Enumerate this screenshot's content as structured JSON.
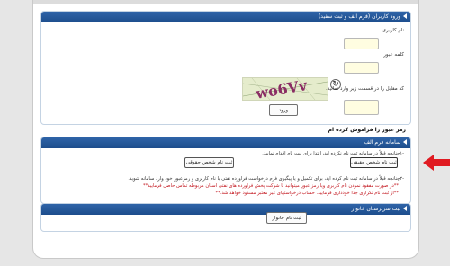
{
  "login": {
    "header": "ورود کاربران (فرم الف و ثبت سفید)",
    "username_label": "نام کاربری",
    "password_label": "کلمه عبور",
    "captcha_instruction": "کد مقابل را در قسمت زیر وارد نمائید.",
    "captcha_text": "wo6Vv",
    "submit_label": "ورود"
  },
  "forgot_password": "رمز عبور را فراموش کرده ام",
  "form_a": {
    "header": "سامانه فرم الف",
    "line1": "-۱چنانچه قبلاً در سامانه ثبت نام نکرده اید، ابتدا برای ثبت نام اقدام نمایید.",
    "natural_person_button": "ثبت نام شخص حقیقی",
    "legal_person_button": "ثبت نام شخص حقوقی",
    "line2": "-۲چنانچه قبلاً در سامانه ثبت نام کرده اید، برای تکمیل و یا پیگیری فرم درخواست فراورده نفتی با نام کاربری و رمزعبور خود وارد سامانه شوید.",
    "note_red1": "**در صورت مفقود نمودن نام کاربری ویا رمز عبور میتوانید با شرکت پخش فراورده های نفتی استان مربوطه تماس حاصل فرمایید**",
    "note_red2": "**از ثبت نام تکراری جدا خودداری فرمایید. حساب درخواستهای غیر معتبر مسدود خواهد شد.**"
  },
  "household": {
    "header": "ثبت سرپرستان خانوار",
    "register_button": "ثبت نام خانوار"
  },
  "colors": {
    "header_blue": "#1d4d8c",
    "input_yellow": "#fffde1",
    "arrow_red": "#e01b22"
  },
  "icons": {
    "refresh": "refresh-icon",
    "arrow": "arrow-left-icon"
  }
}
